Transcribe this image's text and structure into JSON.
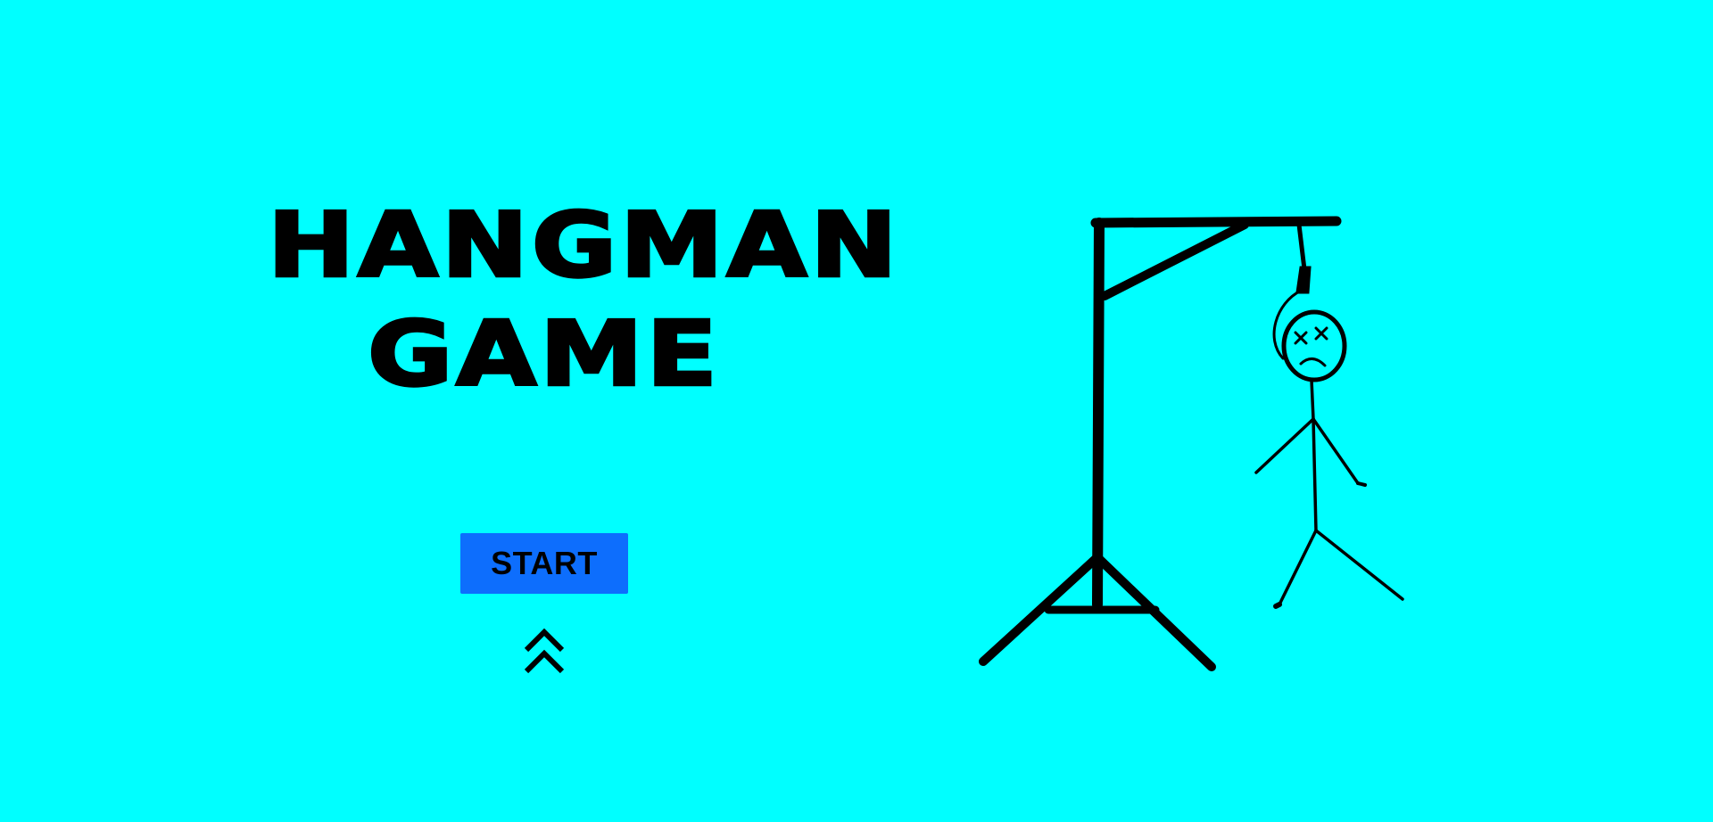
{
  "title": {
    "line1": "HANGMAN",
    "line2": "GAME"
  },
  "start_button": {
    "label": "START"
  },
  "icons": {
    "scroll": "double-chevron-up-icon",
    "illustration": "hangman-gallows-illustration"
  },
  "colors": {
    "background": "#00FFFF",
    "button": "#0D6EFD",
    "ink": "#000000"
  }
}
